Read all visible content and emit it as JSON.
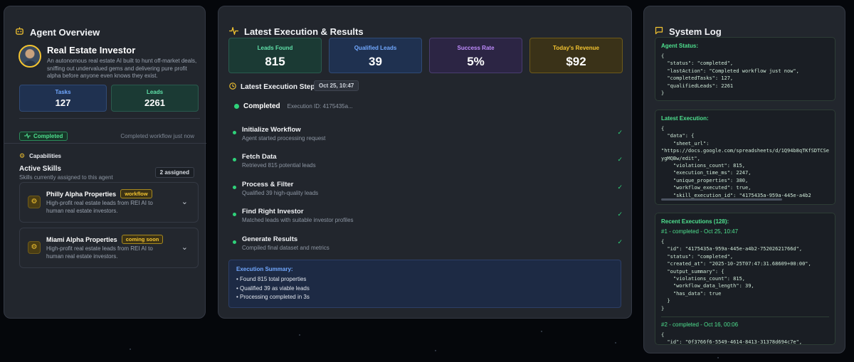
{
  "agent_overview": {
    "title": "Agent Overview",
    "name": "Real Estate Investor",
    "description": "An autonomous real estate AI built to hunt off-market deals, sniffing out undervalued gems and delivering pure profit alpha before anyone even knows they exist.",
    "tasks_label": "Tasks",
    "tasks_value": "127",
    "leads_label": "Leads",
    "leads_value": "2261",
    "status_badge": "Completed",
    "status_text": "Completed workflow just now",
    "capabilities_label": "Capabilities",
    "active_skills_title": "Active Skills",
    "active_skills_sub": "Skills currently assigned to this agent",
    "assigned_badge": "2 assigned",
    "skills": [
      {
        "name": "Philly Alpha Properties",
        "tag": "workflow",
        "desc": "High-profit real estate leads from REI AI to human real estate investors."
      },
      {
        "name": "Miami Alpha Properties",
        "tag": "coming soon",
        "desc": "High-profit real estate leads from REI AI to human real estate investors."
      }
    ]
  },
  "execution": {
    "title": "Latest Execution & Results",
    "metrics": [
      {
        "label": "Leads Found",
        "value": "815"
      },
      {
        "label": "Qualified Leads",
        "value": "39"
      },
      {
        "label": "Success Rate",
        "value": "5%"
      },
      {
        "label": "Today's Revenue",
        "value": "$92"
      }
    ],
    "steps_title": "Latest Execution Steps",
    "date": "Oct 25, 10:47",
    "status": "Completed",
    "execution_id": "Execution ID: 4175435a...",
    "steps": [
      {
        "name": "Initialize Workflow",
        "desc": "Agent started processing request"
      },
      {
        "name": "Fetch Data",
        "desc": "Retrieved 815 potential leads"
      },
      {
        "name": "Process & Filter",
        "desc": "Qualified 39 high-quality leads"
      },
      {
        "name": "Find Right Investor",
        "desc": "Matched leads with suitable investor profiles"
      },
      {
        "name": "Generate Results",
        "desc": "Compiled final dataset and metrics"
      }
    ],
    "summary_title": "Execution Summary:",
    "summary_items": [
      "• Found 815 total properties",
      "• Qualified 39 as viable leads",
      "• Processing completed in 3s"
    ]
  },
  "system_log": {
    "title": "System Log",
    "agent_status_label": "Agent Status:",
    "agent_status_code": "{\n  \"status\": \"completed\",\n  \"lastAction\": \"Completed workflow just now\",\n  \"completedTasks\": 127,\n  \"qualifiedLeads\": 2261\n}",
    "latest_execution_label": "Latest Execution:",
    "latest_execution_code": "{\n  \"data\": {\n    \"sheet_url\":\n\"https://docs.google.com/spreadsheets/d/1Q94b8qTKfSDTCSe\nygMQBw/edit\",\n    \"violations_count\": 815,\n    \"execution_time_ms\": 2247,\n    \"unique_properties\": 380,\n    \"workflow_executed\": true,\n    \"skill_execution_id\": \"4175435a-959a-445e-a4b2",
    "recent_label": "Recent Executions (128):",
    "recent": [
      {
        "header": "#1 - completed - Oct 25, 10:47",
        "code": "{\n  \"id\": \"4175435a-959a-445e-a4b2-75202621766d\",\n  \"status\": \"completed\",\n  \"created_at\": \"2025-10-25T07:47:31.68609+00:00\",\n  \"output_summary\": {\n    \"violations_count\": 815,\n    \"workflow_data_length\": 39,\n    \"has_data\": true\n  }\n}"
      },
      {
        "header": "#2 - completed - Oct 16, 00:06",
        "code": "{\n  \"id\": \"0f3766f6-5549-4614-8413-31378d694c7e\","
      }
    ]
  },
  "colors": {
    "accent_yellow": "#f4c430",
    "success_green": "#2fd27a",
    "info_blue": "#71a8ff",
    "purple": "#c08cff"
  }
}
